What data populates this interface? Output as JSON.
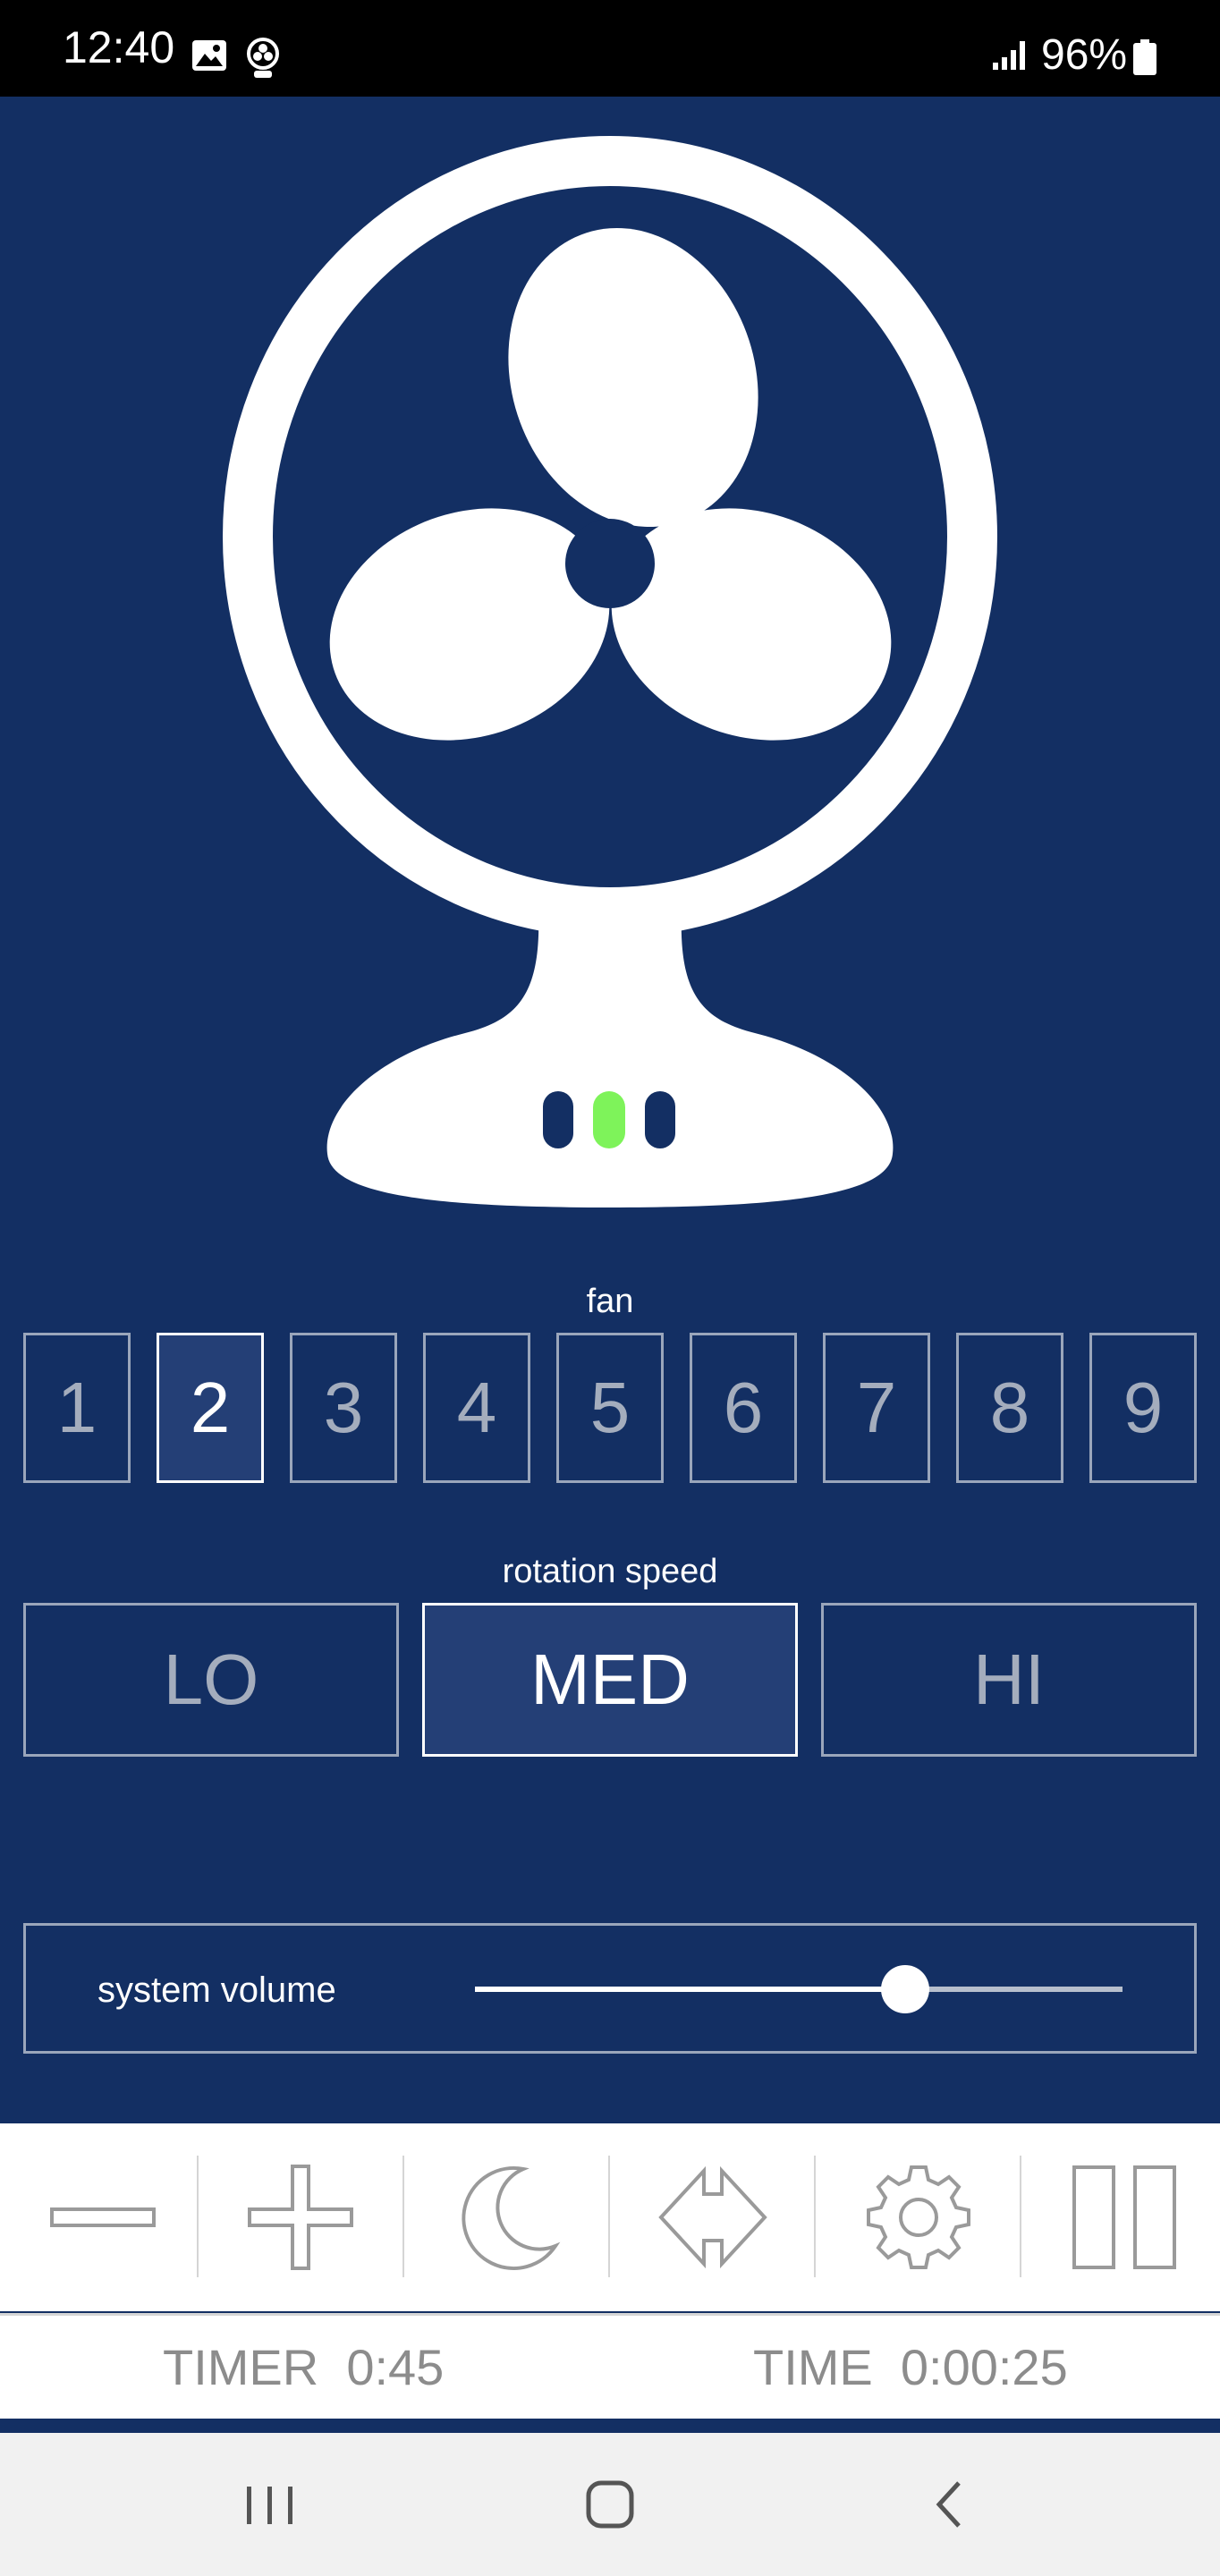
{
  "status_bar": {
    "time": "12:40",
    "battery": "96%",
    "icons": [
      "image-icon",
      "fan-notification-icon",
      "signal-icon",
      "battery-icon"
    ]
  },
  "fan_selector": {
    "label": "fan",
    "options": [
      "1",
      "2",
      "3",
      "4",
      "5",
      "6",
      "7",
      "8",
      "9"
    ],
    "selected": "2"
  },
  "rotation_speed": {
    "label": "rotation speed",
    "options": [
      "LO",
      "MED",
      "HI"
    ],
    "selected": "MED"
  },
  "volume": {
    "label": "system volume",
    "level": 0.665
  },
  "fan_indicator_lights": {
    "colors": [
      "#132f63",
      "#7ef35a",
      "#132f63"
    ],
    "active_index": 1
  },
  "toolbar": {
    "buttons": [
      "minus-icon",
      "plus-icon",
      "moon-icon",
      "oscillation-arrows-icon",
      "gear-icon",
      "pause-icon"
    ]
  },
  "info": {
    "timer": "TIMER  0:45",
    "time": "TIME  0:00:25"
  },
  "colors": {
    "background": "#132f63",
    "selected_button": "#243f76",
    "indicator_active": "#7ef35a"
  }
}
